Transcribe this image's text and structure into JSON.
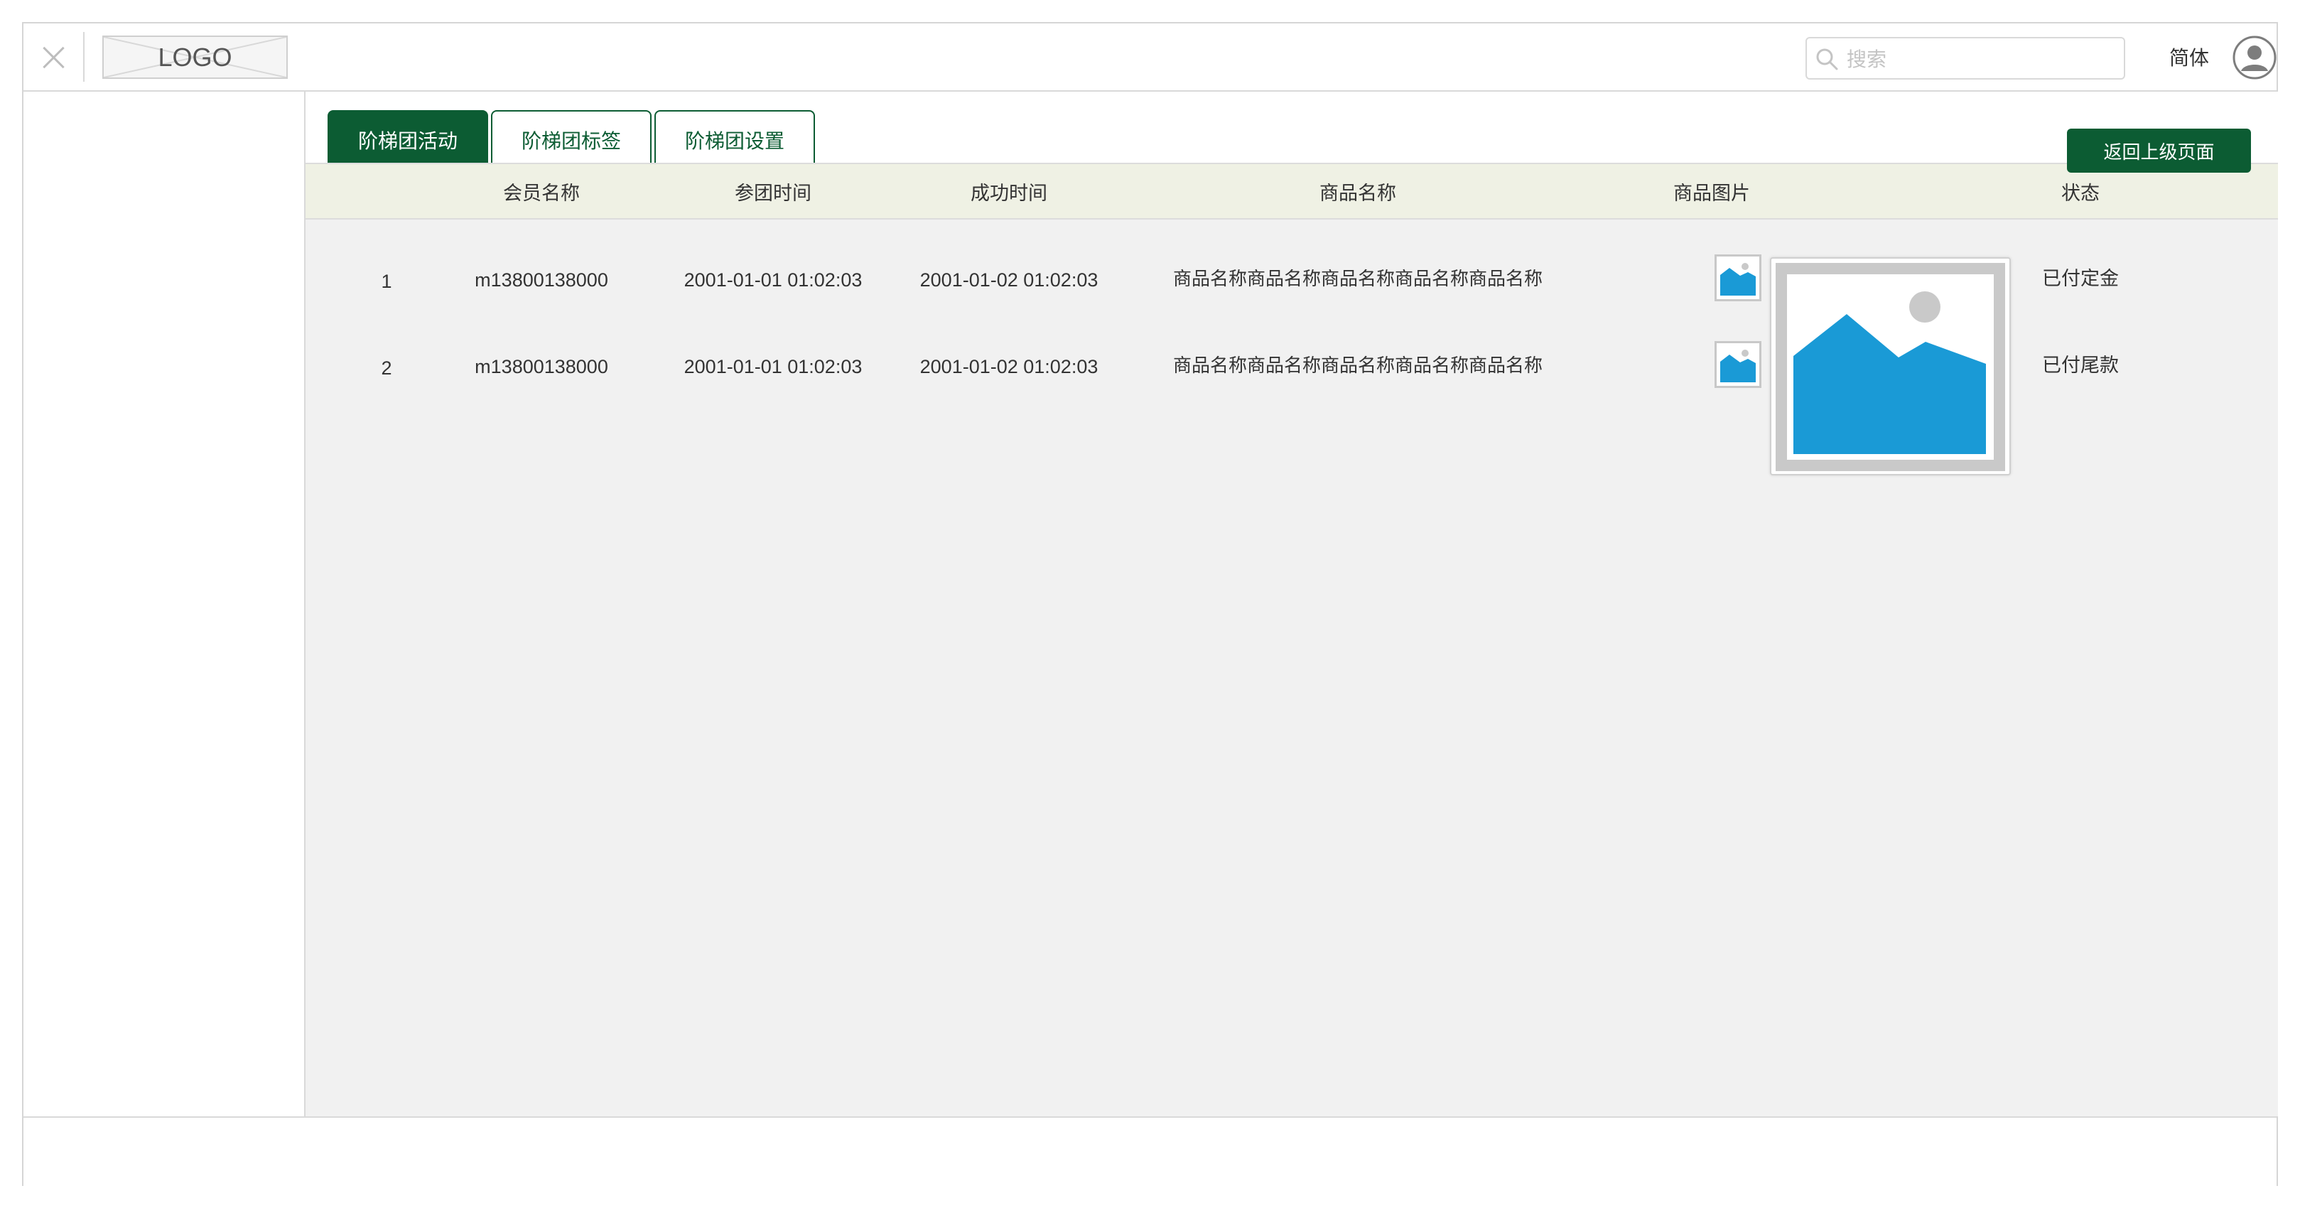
{
  "header": {
    "logo_text": "LOGO",
    "search_placeholder": "搜索",
    "language": "简体"
  },
  "tabs": [
    {
      "label": "阶梯团活动",
      "active": true
    },
    {
      "label": "阶梯团标签",
      "active": false
    },
    {
      "label": "阶梯团设置",
      "active": false
    }
  ],
  "back_button": "返回上级页面",
  "table": {
    "columns": [
      "会员名称",
      "参团时间",
      "成功时间",
      "商品名称",
      "商品图片",
      "状态"
    ],
    "rows": [
      {
        "index": "1",
        "member": "m13800138000",
        "join_time": "2001-01-01 01:02:03",
        "success_time": "2001-01-02 01:02:03",
        "product_name": "商品名称商品名称商品名称商品名称商品名称",
        "status": "已付定金"
      },
      {
        "index": "2",
        "member": "m13800138000",
        "join_time": "2001-01-01 01:02:03",
        "success_time": "2001-01-02 01:02:03",
        "product_name": "商品名称商品名称商品名称商品名称商品名称",
        "status": "已付尾款"
      }
    ]
  },
  "colors": {
    "primary": "#0c5c33",
    "header_row_bg": "#eff1e4",
    "content_bg": "#f1f1f1",
    "image_blue": "#1a9ad6"
  },
  "icons": [
    "close-icon",
    "search-icon",
    "avatar-icon",
    "image-placeholder-icon"
  ]
}
